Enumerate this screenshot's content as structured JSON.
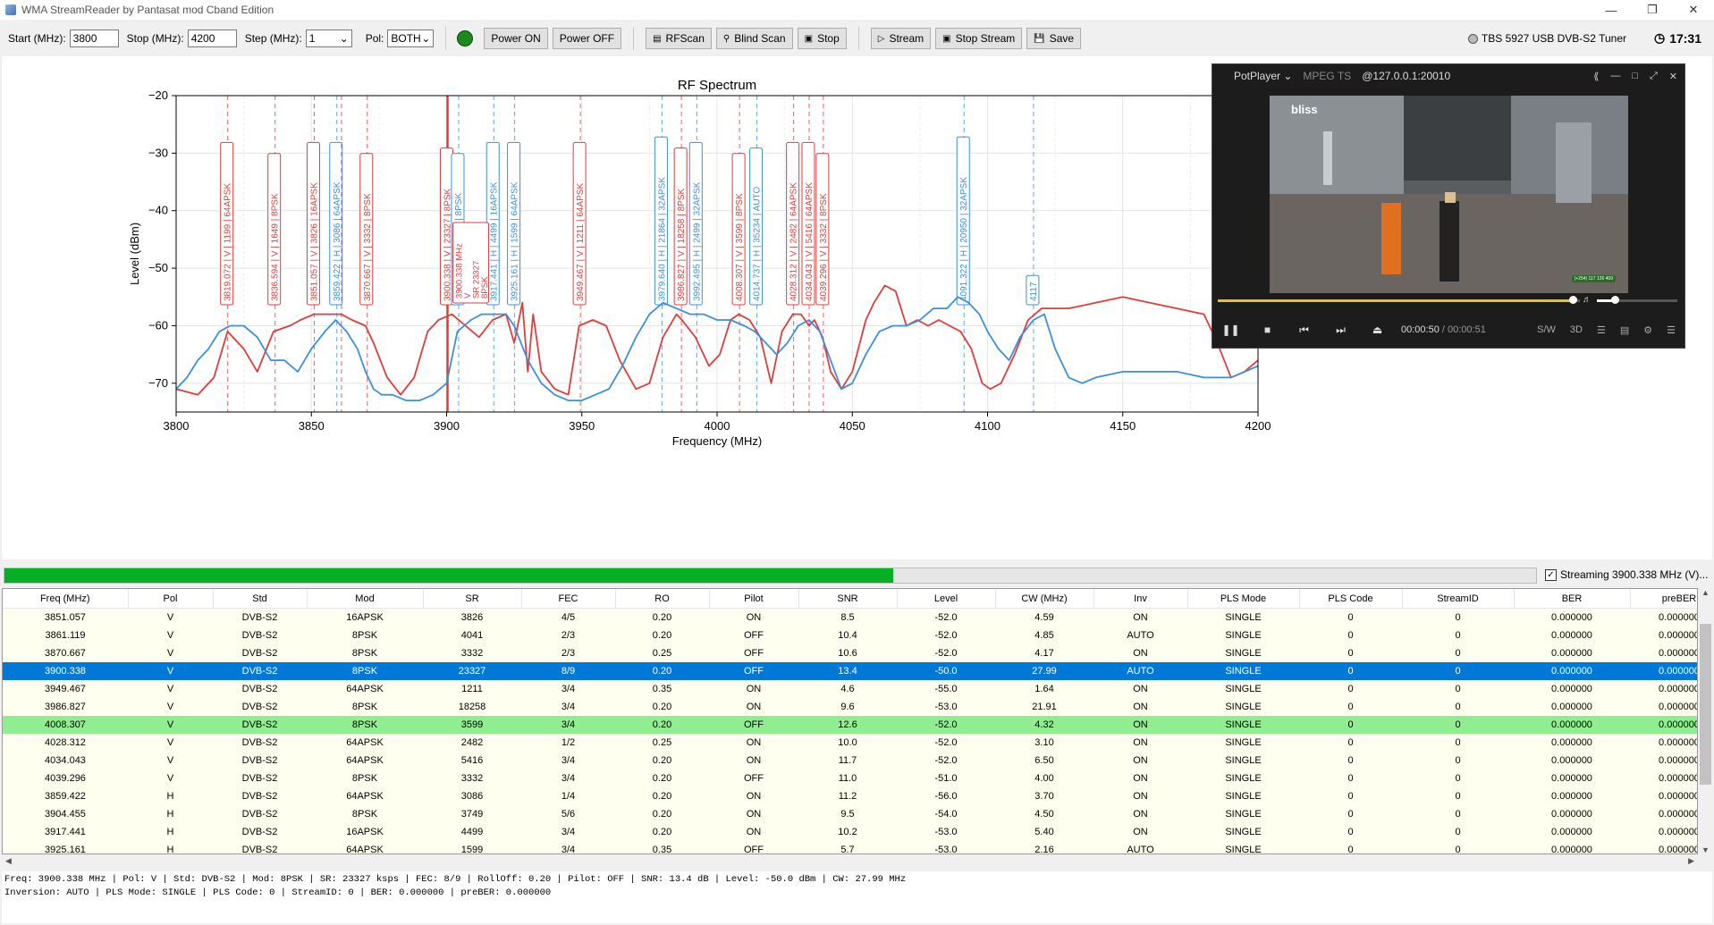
{
  "window": {
    "title": "WMA StreamReader by Pantasat mod Cband Edition"
  },
  "toolbar": {
    "start_label": "Start (MHz):",
    "start_value": "3800",
    "stop_label": "Stop (MHz):",
    "stop_value": "4200",
    "step_label": "Step (MHz):",
    "step_value": "1",
    "pol_label": "Pol:",
    "pol_value": "BOTH",
    "power_on": "Power ON",
    "power_off": "Power OFF",
    "rfscan": "RFScan",
    "blind_scan": "Blind Scan",
    "stop": "Stop",
    "stream": "Stream",
    "stop_stream": "Stop Stream",
    "save": "Save",
    "tuner_name": "TBS 5927 USB DVB-S2 Tuner",
    "clock": "17:31"
  },
  "chart_data": {
    "type": "line",
    "title": "RF Spectrum",
    "xlabel": "Frequency (MHz)",
    "ylabel": "Level (dBm)",
    "xlim": [
      3800,
      4200
    ],
    "ylim": [
      -75,
      -20
    ],
    "x_ticks": [
      3800,
      3850,
      3900,
      3950,
      4000,
      4050,
      4100,
      4150,
      4200
    ],
    "y_ticks": [
      -20,
      -30,
      -40,
      -50,
      -60,
      -70
    ],
    "grid": true,
    "colors": {
      "V": "#e03c3c",
      "H": "#3c8fdc"
    },
    "series": [
      {
        "pol": "V",
        "x": [
          3800,
          3808,
          3814,
          3819,
          3825,
          3830,
          3836,
          3842,
          3846,
          3851,
          3856,
          3861,
          3865,
          3870,
          3873,
          3878,
          3883,
          3888,
          3893,
          3897,
          3902,
          3907,
          3912,
          3917,
          3922,
          3925,
          3928,
          3930,
          3932,
          3935,
          3940,
          3945,
          3949,
          3954,
          3959,
          3964,
          3970,
          3975,
          3980,
          3985,
          3987,
          3992,
          3997,
          4001,
          4005,
          4008,
          4012,
          4016,
          4020,
          4024,
          4028,
          4031,
          4034,
          4036,
          4039,
          4042,
          4046,
          4050,
          4055,
          4058,
          4062,
          4066,
          4070,
          4074,
          4078,
          4082,
          4086,
          4090,
          4094,
          4098,
          4101,
          4105,
          4110,
          4115,
          4120,
          4125,
          4130,
          4140,
          4150,
          4160,
          4170,
          4180,
          4185,
          4190,
          4195,
          4200
        ],
        "y": [
          -71,
          -72,
          -69,
          -61,
          -64,
          -68,
          -61,
          -60,
          -59,
          -58,
          -58,
          -58,
          -59,
          -60,
          -63,
          -69,
          -72,
          -69,
          -61,
          -59,
          -58,
          -60,
          -62,
          -59,
          -58,
          -63,
          -56,
          -68,
          -58,
          -68,
          -71,
          -72,
          -60,
          -59,
          -60,
          -66,
          -71,
          -70,
          -62,
          -58,
          -59,
          -62,
          -67,
          -65,
          -59,
          -58,
          -59,
          -62,
          -70,
          -61,
          -58,
          -58,
          -60,
          -59,
          -62,
          -68,
          -71,
          -68,
          -59,
          -56,
          -53,
          -54,
          -60,
          -59,
          -60,
          -59,
          -60,
          -61,
          -64,
          -70,
          -71,
          -70,
          -65,
          -59,
          -57,
          -57,
          -57,
          -56,
          -55,
          -56,
          -57,
          -58,
          -63,
          -69,
          -68,
          -66
        ]
      },
      {
        "pol": "H",
        "x": [
          3800,
          3804,
          3808,
          3812,
          3816,
          3820,
          3825,
          3830,
          3835,
          3840,
          3845,
          3850,
          3855,
          3859,
          3863,
          3867,
          3870,
          3873,
          3876,
          3880,
          3885,
          3890,
          3895,
          3900,
          3904,
          3909,
          3913,
          3917,
          3922,
          3925,
          3930,
          3935,
          3940,
          3945,
          3950,
          3955,
          3960,
          3965,
          3970,
          3975,
          3980,
          3985,
          3990,
          3995,
          4000,
          4005,
          4010,
          4014,
          4018,
          4022,
          4026,
          4030,
          4034,
          4038,
          4042,
          4046,
          4050,
          4055,
          4060,
          4065,
          4070,
          4075,
          4080,
          4085,
          4089,
          4093,
          4097,
          4100,
          4104,
          4108,
          4112,
          4117,
          4121,
          4125,
          4130,
          4135,
          4140,
          4150,
          4160,
          4170,
          4180,
          4190,
          4200
        ],
        "y": [
          -71,
          -69,
          -66,
          -64,
          -61,
          -60,
          -60,
          -62,
          -66,
          -66,
          -68,
          -64,
          -61,
          -59,
          -61,
          -64,
          -68,
          -71,
          -72,
          -72,
          -73,
          -73,
          -72,
          -70,
          -61,
          -59,
          -58,
          -58,
          -58,
          -60,
          -66,
          -70,
          -72,
          -73,
          -73,
          -72,
          -71,
          -67,
          -62,
          -58,
          -56,
          -57,
          -58,
          -58,
          -59,
          -59,
          -60,
          -61,
          -63,
          -65,
          -63,
          -60,
          -59,
          -61,
          -66,
          -71,
          -70,
          -65,
          -61,
          -60,
          -60,
          -59,
          -57,
          -57,
          -55,
          -56,
          -58,
          -61,
          -64,
          -66,
          -62,
          -59,
          -58,
          -64,
          -69,
          -70,
          -69,
          -68,
          -68,
          -68,
          -69,
          -69,
          -67
        ]
      }
    ],
    "markers": [
      {
        "freq": 3819.072,
        "pol": "V",
        "label": "3819.072 | V | 1199 | 64APSK"
      },
      {
        "freq": 3836.594,
        "pol": "V",
        "label": "3836.594 | V | 1649 | 8PSK"
      },
      {
        "freq": 3851.057,
        "pol": "V",
        "label": "3851.057 | V | 3826 | 16APSK"
      },
      {
        "freq": 3859.422,
        "pol": "H",
        "label": "3859.422 | H | 3086 | 64APSK"
      },
      {
        "freq": 3861.119,
        "pol": "V",
        "label": ""
      },
      {
        "freq": 3870.667,
        "pol": "V",
        "label": "3870.667 | V | 3332 | 8PSK"
      },
      {
        "freq": 3900.338,
        "pol": "V",
        "label": "3900.338 | V | 23327 | 8PSK"
      },
      {
        "freq": 3904.455,
        "pol": "H",
        "label": "3904.455 | H | 3749 | 8PSK"
      },
      {
        "freq": 3917.441,
        "pol": "H",
        "label": "3917.441 | H | 4499 | 16APSK"
      },
      {
        "freq": 3925.161,
        "pol": "H",
        "label": "3925.161 | H | 1599 | 64APSK"
      },
      {
        "freq": 3949.467,
        "pol": "V",
        "label": "3949.467 | V | 1211 | 64APSK"
      },
      {
        "freq": 3979.64,
        "pol": "H",
        "label": "3979.640 | H | 21864 | 32APSK"
      },
      {
        "freq": 3986.827,
        "pol": "V",
        "label": "3986.827 | V | 18258 | 8PSK"
      },
      {
        "freq": 3992.495,
        "pol": "H",
        "label": "3992.495 | H | 2499 | 32APSK"
      },
      {
        "freq": 4008.307,
        "pol": "V",
        "label": "4008.307 | V | 3599 | 8PSK"
      },
      {
        "freq": 4014.737,
        "pol": "H",
        "label": "4014.737 | H | 35234 | AUTO"
      },
      {
        "freq": 4028.312,
        "pol": "V",
        "label": "4028.312 | V | 2482 | 64APSK"
      },
      {
        "freq": 4034.043,
        "pol": "V",
        "label": "4034.043 | V | 5416 | 64APSK"
      },
      {
        "freq": 4039.296,
        "pol": "V",
        "label": "4039.296 | V | 3332 | 8PSK"
      },
      {
        "freq": 4091.322,
        "pol": "H",
        "label": "4091.322 | H | 20950 | 32APSK"
      },
      {
        "freq": 4117,
        "pol": "H",
        "label": "4117"
      }
    ],
    "highlight": {
      "freq": 3900.338,
      "lines": [
        "3900.338 MHz",
        "V",
        "SR 23327",
        "8PSK"
      ]
    }
  },
  "player": {
    "app": "PotPlayer",
    "format": "MPEG TS",
    "source": "@127.0.0.1:20010",
    "logo": "bliss",
    "phone": "(+254) 117 126 409",
    "time": "00:00:50",
    "duration": "/ 00:00:51",
    "progress": 0.98,
    "sw": "S/W",
    "mode3d": "3D"
  },
  "progress": {
    "fraction": 0.58
  },
  "streaming": {
    "label": "Streaming 3900.338 MHz (V)..."
  },
  "table": {
    "columns": [
      "Freq (MHz)",
      "Pol",
      "Std",
      "Mod",
      "SR",
      "FEC",
      "RO",
      "Pilot",
      "SNR",
      "Level",
      "CW (MHz)",
      "Inv",
      "PLS Mode",
      "PLS Code",
      "StreamID",
      "BER",
      "preBER"
    ],
    "rows": [
      [
        "3851.057",
        "V",
        "DVB-S2",
        "16APSK",
        "3826",
        "4/5",
        "0.20",
        "ON",
        "8.5",
        "-52.0",
        "4.59",
        "ON",
        "SINGLE",
        "0",
        "0",
        "0.000000",
        "0.000000"
      ],
      [
        "3861.119",
        "V",
        "DVB-S2",
        "8PSK",
        "4041",
        "2/3",
        "0.20",
        "OFF",
        "10.4",
        "-52.0",
        "4.85",
        "AUTO",
        "SINGLE",
        "0",
        "0",
        "0.000000",
        "0.000000"
      ],
      [
        "3870.667",
        "V",
        "DVB-S2",
        "8PSK",
        "3332",
        "2/3",
        "0.25",
        "OFF",
        "10.6",
        "-52.0",
        "4.17",
        "ON",
        "SINGLE",
        "0",
        "0",
        "0.000000",
        "0.000000"
      ],
      [
        "3900.338",
        "V",
        "DVB-S2",
        "8PSK",
        "23327",
        "8/9",
        "0.20",
        "OFF",
        "13.4",
        "-50.0",
        "27.99",
        "AUTO",
        "SINGLE",
        "0",
        "0",
        "0.000000",
        "0.000000"
      ],
      [
        "3949.467",
        "V",
        "DVB-S2",
        "64APSK",
        "1211",
        "3/4",
        "0.35",
        "ON",
        "4.6",
        "-55.0",
        "1.64",
        "ON",
        "SINGLE",
        "0",
        "0",
        "0.000000",
        "0.000000"
      ],
      [
        "3986.827",
        "V",
        "DVB-S2",
        "8PSK",
        "18258",
        "3/4",
        "0.20",
        "ON",
        "9.6",
        "-53.0",
        "21.91",
        "ON",
        "SINGLE",
        "0",
        "0",
        "0.000000",
        "0.000000"
      ],
      [
        "4008.307",
        "V",
        "DVB-S2",
        "8PSK",
        "3599",
        "3/4",
        "0.20",
        "OFF",
        "12.6",
        "-52.0",
        "4.32",
        "ON",
        "SINGLE",
        "0",
        "0",
        "0.000000",
        "0.000000"
      ],
      [
        "4028.312",
        "V",
        "DVB-S2",
        "64APSK",
        "2482",
        "1/2",
        "0.25",
        "ON",
        "10.0",
        "-52.0",
        "3.10",
        "ON",
        "SINGLE",
        "0",
        "0",
        "0.000000",
        "0.000000"
      ],
      [
        "4034.043",
        "V",
        "DVB-S2",
        "64APSK",
        "5416",
        "3/4",
        "0.20",
        "ON",
        "11.7",
        "-52.0",
        "6.50",
        "ON",
        "SINGLE",
        "0",
        "0",
        "0.000000",
        "0.000000"
      ],
      [
        "4039.296",
        "V",
        "DVB-S2",
        "8PSK",
        "3332",
        "3/4",
        "0.20",
        "OFF",
        "11.0",
        "-51.0",
        "4.00",
        "ON",
        "SINGLE",
        "0",
        "0",
        "0.000000",
        "0.000000"
      ],
      [
        "3859.422",
        "H",
        "DVB-S2",
        "64APSK",
        "3086",
        "1/4",
        "0.20",
        "ON",
        "11.2",
        "-56.0",
        "3.70",
        "ON",
        "SINGLE",
        "0",
        "0",
        "0.000000",
        "0.000000"
      ],
      [
        "3904.455",
        "H",
        "DVB-S2",
        "8PSK",
        "3749",
        "5/6",
        "0.20",
        "ON",
        "9.5",
        "-54.0",
        "4.50",
        "ON",
        "SINGLE",
        "0",
        "0",
        "0.000000",
        "0.000000"
      ],
      [
        "3917.441",
        "H",
        "DVB-S2",
        "16APSK",
        "4499",
        "3/4",
        "0.20",
        "ON",
        "10.2",
        "-53.0",
        "5.40",
        "ON",
        "SINGLE",
        "0",
        "0",
        "0.000000",
        "0.000000"
      ],
      [
        "3925.161",
        "H",
        "DVB-S2",
        "64APSK",
        "1599",
        "3/4",
        "0.35",
        "OFF",
        "5.7",
        "-53.0",
        "2.16",
        "AUTO",
        "SINGLE",
        "0",
        "0",
        "0.000000",
        "0.000000"
      ]
    ],
    "selected": 3,
    "streaming_row": 6
  },
  "info": {
    "line1": "Freq: 3900.338 MHz | Pol: V | Std: DVB-S2 | Mod: 8PSK | SR: 23327 ksps | FEC: 8/9 | RollOff: 0.20 | Pilot: OFF | SNR: 13.4 dB | Level: -50.0 dBm | CW: 27.99 MHz",
    "line2": "Inversion: AUTO | PLS Mode: SINGLE | PLS Code: 0 | StreamID: 0 | BER: 0.000000 | preBER: 0.000000"
  }
}
